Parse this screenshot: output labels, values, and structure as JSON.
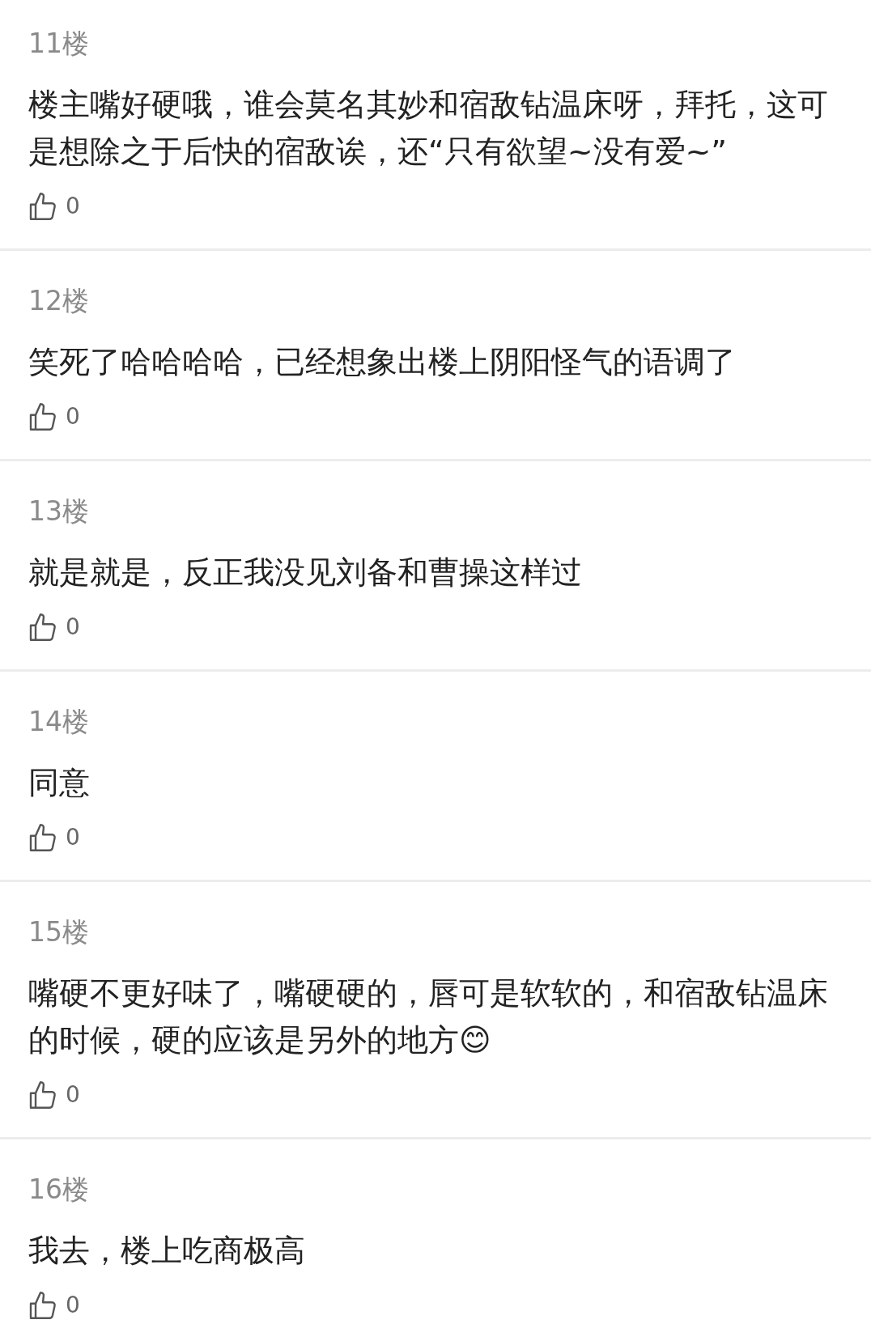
{
  "comments": [
    {
      "floor": "11楼",
      "text": "楼主嘴好硬哦，谁会莫名其妙和宿敌钻温床呀，拜托，这可是想除之于后快的宿敌诶，还“只有欲望~没有爱~”",
      "likes": "0"
    },
    {
      "floor": "12楼",
      "text": "笑死了哈哈哈哈，已经想象出楼上阴阳怪气的语调了",
      "likes": "0"
    },
    {
      "floor": "13楼",
      "text": "就是就是，反正我没见刘备和曹操这样过",
      "likes": "0"
    },
    {
      "floor": "14楼",
      "text": "同意",
      "likes": "0"
    },
    {
      "floor": "15楼",
      "text": "嘴硬不更好味了，嘴硬硬的，唇可是软软的，和宿敌钻温床的时候，硬的应该是另外的地方😊",
      "likes": "0"
    },
    {
      "floor": "16楼",
      "text": "我去，楼上吃商极高",
      "likes": "0"
    }
  ]
}
